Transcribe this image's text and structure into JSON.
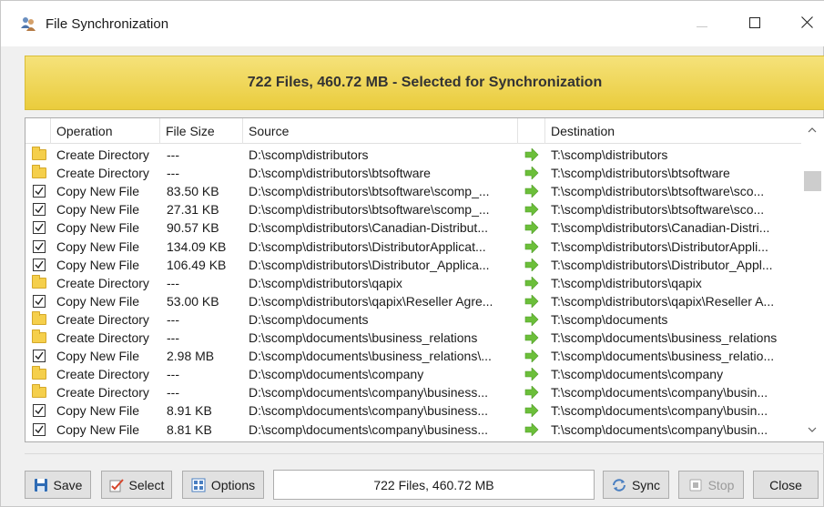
{
  "window": {
    "title": "File Synchronization",
    "icon": "people-sync-icon",
    "controls": {
      "minimize": "minimize-icon",
      "maximize": "maximize-icon",
      "close": "close-icon"
    }
  },
  "banner": {
    "text": "722 Files, 460.72 MB - Selected for Synchronization",
    "color": "#eacc3c"
  },
  "table": {
    "columns": [
      "Operation",
      "File Size",
      "Source",
      "",
      "Destination"
    ],
    "rows": [
      {
        "type": "folder",
        "operation": "Create Directory",
        "size": "---",
        "source": "D:\\scomp\\distributors",
        "destination": "T:\\scomp\\distributors"
      },
      {
        "type": "folder",
        "operation": "Create Directory",
        "size": "---",
        "source": "D:\\scomp\\distributors\\btsoftware",
        "destination": "T:\\scomp\\distributors\\btsoftware"
      },
      {
        "type": "check",
        "operation": "Copy New File",
        "size": "83.50 KB",
        "source": "D:\\scomp\\distributors\\btsoftware\\scomp_...",
        "destination": "T:\\scomp\\distributors\\btsoftware\\sco..."
      },
      {
        "type": "check",
        "operation": "Copy New File",
        "size": "27.31 KB",
        "source": "D:\\scomp\\distributors\\btsoftware\\scomp_...",
        "destination": "T:\\scomp\\distributors\\btsoftware\\sco..."
      },
      {
        "type": "check",
        "operation": "Copy New File",
        "size": "90.57 KB",
        "source": "D:\\scomp\\distributors\\Canadian-Distribut...",
        "destination": "T:\\scomp\\distributors\\Canadian-Distri..."
      },
      {
        "type": "check",
        "operation": "Copy New File",
        "size": "134.09 KB",
        "source": "D:\\scomp\\distributors\\DistributorApplicat...",
        "destination": "T:\\scomp\\distributors\\DistributorAppli..."
      },
      {
        "type": "check",
        "operation": "Copy New File",
        "size": "106.49 KB",
        "source": "D:\\scomp\\distributors\\Distributor_Applica...",
        "destination": "T:\\scomp\\distributors\\Distributor_Appl..."
      },
      {
        "type": "folder",
        "operation": "Create Directory",
        "size": "---",
        "source": "D:\\scomp\\distributors\\qapix",
        "destination": "T:\\scomp\\distributors\\qapix"
      },
      {
        "type": "check",
        "operation": "Copy New File",
        "size": "53.00 KB",
        "source": "D:\\scomp\\distributors\\qapix\\Reseller Agre...",
        "destination": "T:\\scomp\\distributors\\qapix\\Reseller A..."
      },
      {
        "type": "folder",
        "operation": "Create Directory",
        "size": "---",
        "source": "D:\\scomp\\documents",
        "destination": "T:\\scomp\\documents"
      },
      {
        "type": "folder",
        "operation": "Create Directory",
        "size": "---",
        "source": "D:\\scomp\\documents\\business_relations",
        "destination": "T:\\scomp\\documents\\business_relations"
      },
      {
        "type": "check",
        "operation": "Copy New File",
        "size": "2.98 MB",
        "source": "D:\\scomp\\documents\\business_relations\\...",
        "destination": "T:\\scomp\\documents\\business_relatio..."
      },
      {
        "type": "folder",
        "operation": "Create Directory",
        "size": "---",
        "source": "D:\\scomp\\documents\\company",
        "destination": "T:\\scomp\\documents\\company"
      },
      {
        "type": "folder",
        "operation": "Create Directory",
        "size": "---",
        "source": "D:\\scomp\\documents\\company\\business...",
        "destination": "T:\\scomp\\documents\\company\\busin..."
      },
      {
        "type": "check",
        "operation": "Copy New File",
        "size": "8.91 KB",
        "source": "D:\\scomp\\documents\\company\\business...",
        "destination": "T:\\scomp\\documents\\company\\busin..."
      },
      {
        "type": "check",
        "operation": "Copy New File",
        "size": "8.81 KB",
        "source": "D:\\scomp\\documents\\company\\business...",
        "destination": "T:\\scomp\\documents\\company\\busin..."
      }
    ]
  },
  "footer": {
    "save": "Save",
    "select": "Select",
    "options": "Options",
    "status": "722 Files, 460.72 MB",
    "sync": "Sync",
    "stop": "Stop",
    "close": "Close"
  }
}
